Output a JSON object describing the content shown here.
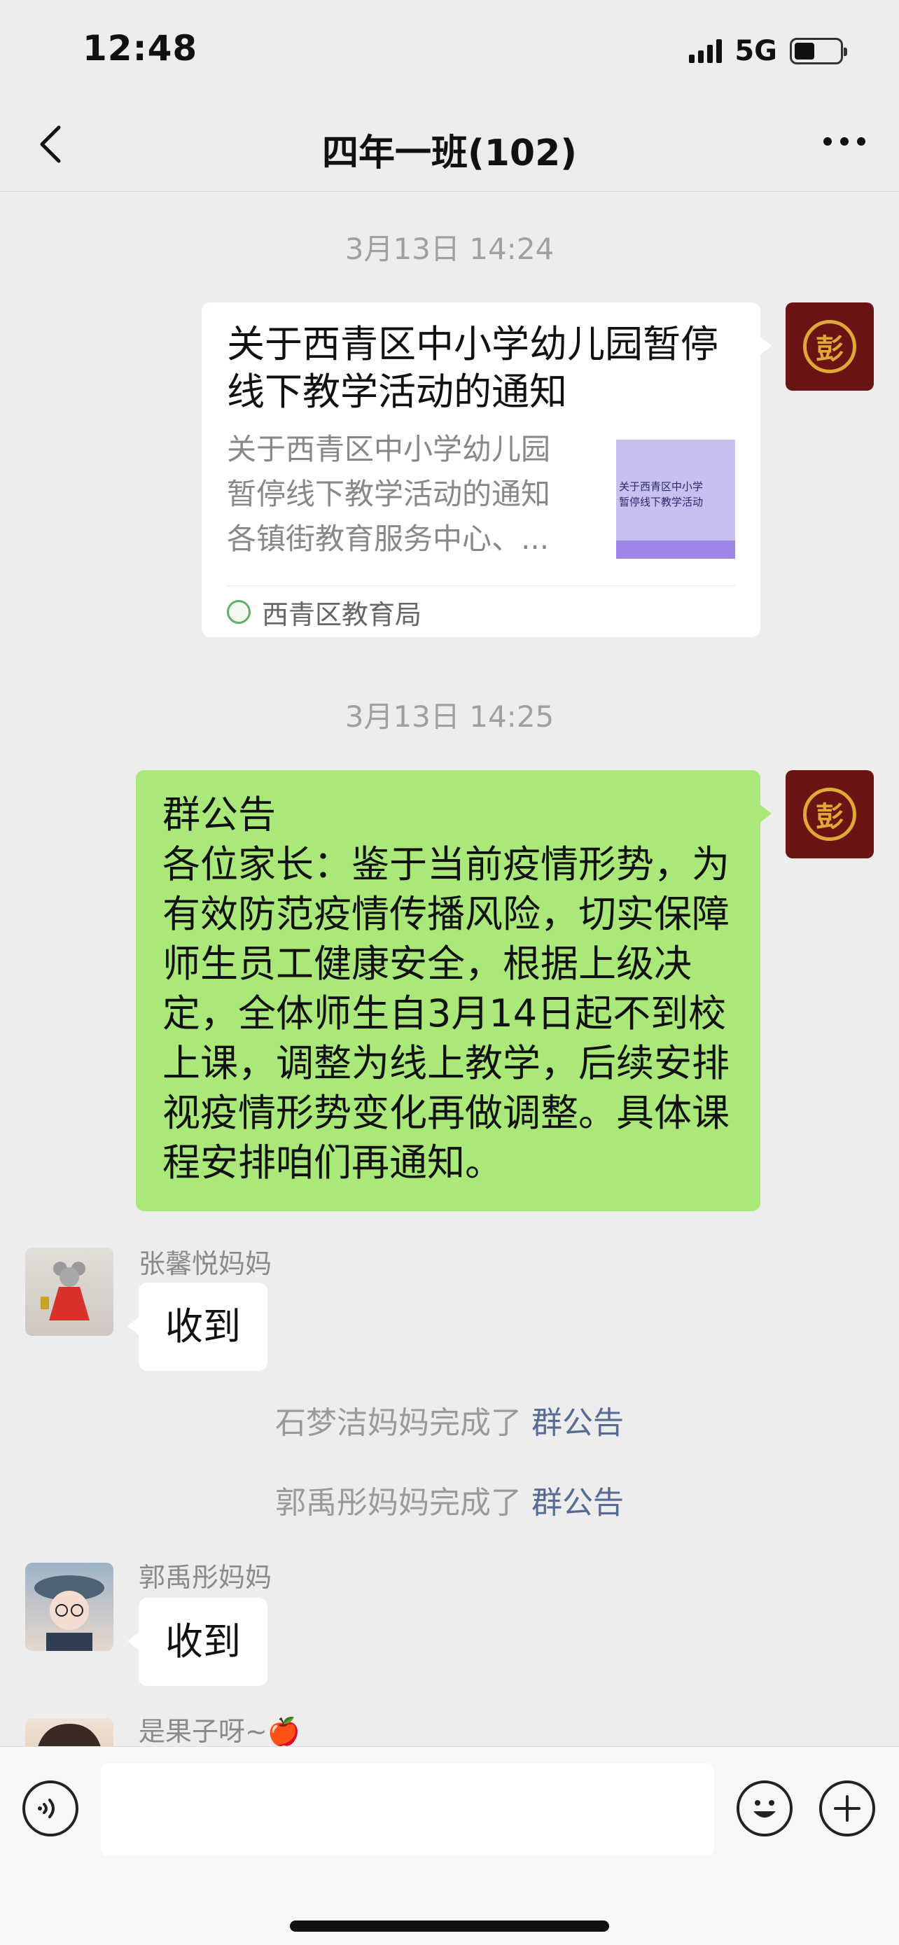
{
  "status_bar": {
    "time": "12:48",
    "network": "5G",
    "battery_level": 0.45
  },
  "nav": {
    "title": "四年一班(102)"
  },
  "messages": {
    "ts1": "3月13日 14:24",
    "card": {
      "title": "关于西青区中小学幼儿园暂停线下教学活动的通知",
      "desc_lines": [
        "关于西青区中小学幼儿园",
        "暂停线下教学活动的通知",
        " 各镇街教育服务中心、..."
      ],
      "thumb_lines": [
        "关于西青区中小学",
        "暂停线下教学活动"
      ],
      "source": "西青区教育局"
    },
    "ts2": "3月13日 14:25",
    "announcement": "群公告\n各位家长：鉴于当前疫情形势，为有效防范疫情传播风险，切实保障师生员工健康安全，根据上级决定，全体师生自3月14日起不到校上课，调整为线上教学，后续安排视疫情形势变化再做调整。具体课程安排咱们再通知。",
    "reply1": {
      "sender": "张馨悦妈妈",
      "text": "收到"
    },
    "sys1": {
      "prefix": "石梦洁妈妈完成了 ",
      "link": "群公告"
    },
    "sys2": {
      "prefix": "郭禹彤妈妈完成了 ",
      "link": "群公告"
    },
    "reply2": {
      "sender": "郭禹彤妈妈",
      "text": "收到"
    },
    "reply3": {
      "sender": "是果子呀~🍎"
    }
  },
  "self_avatar_text": "彭",
  "icons": [
    "back-icon",
    "more-icon",
    "voice-icon",
    "emoji-icon",
    "plus-icon"
  ]
}
